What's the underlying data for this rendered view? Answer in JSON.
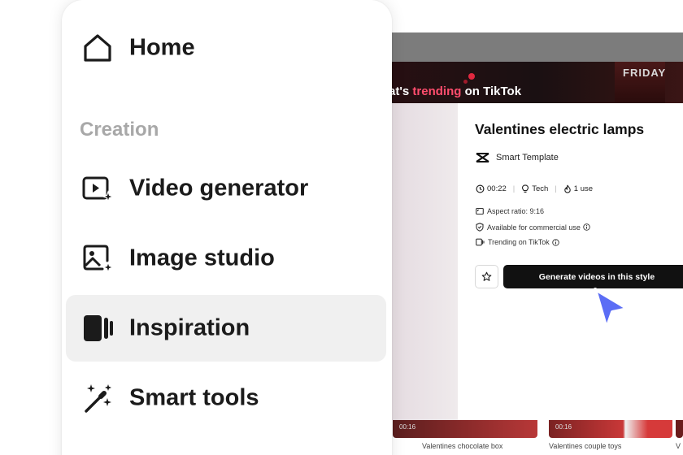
{
  "menu": {
    "home_label": "Home",
    "section_label": "Creation",
    "items": [
      {
        "label": "Video generator",
        "icon": "video-generator-icon",
        "active": false
      },
      {
        "label": "Image studio",
        "icon": "image-studio-icon",
        "active": false
      },
      {
        "label": "Inspiration",
        "icon": "inspiration-icon",
        "active": true
      },
      {
        "label": "Smart tools",
        "icon": "magic-wand-icon",
        "active": false
      }
    ]
  },
  "banner": {
    "text_prefix": "at's ",
    "text_highlight": "trending",
    "text_suffix": " on TikTok",
    "thumb_text": "FRIDAY"
  },
  "details": {
    "title": "Valentines electric lamps",
    "template_label": "Smart Template",
    "duration": "00:22",
    "category": "Tech",
    "uses": "1 use",
    "aspect_ratio": "Aspect ratio: 9:16",
    "commercial": "Available for commercial use",
    "trending": "Trending on TikTok",
    "generate_label": "Generate videos in this style"
  },
  "thumbnails": [
    {
      "duration": "00:16",
      "caption": "Valentines chocolate box"
    },
    {
      "duration": "00:16",
      "caption": "Valentines couple toys"
    },
    {
      "duration": "",
      "caption": "V"
    }
  ],
  "colors": {
    "accent_highlight": "#ff4d6d",
    "button_dark": "#111111",
    "cursor": "#5b6df5",
    "active_item_bg": "#f0f0f0"
  }
}
